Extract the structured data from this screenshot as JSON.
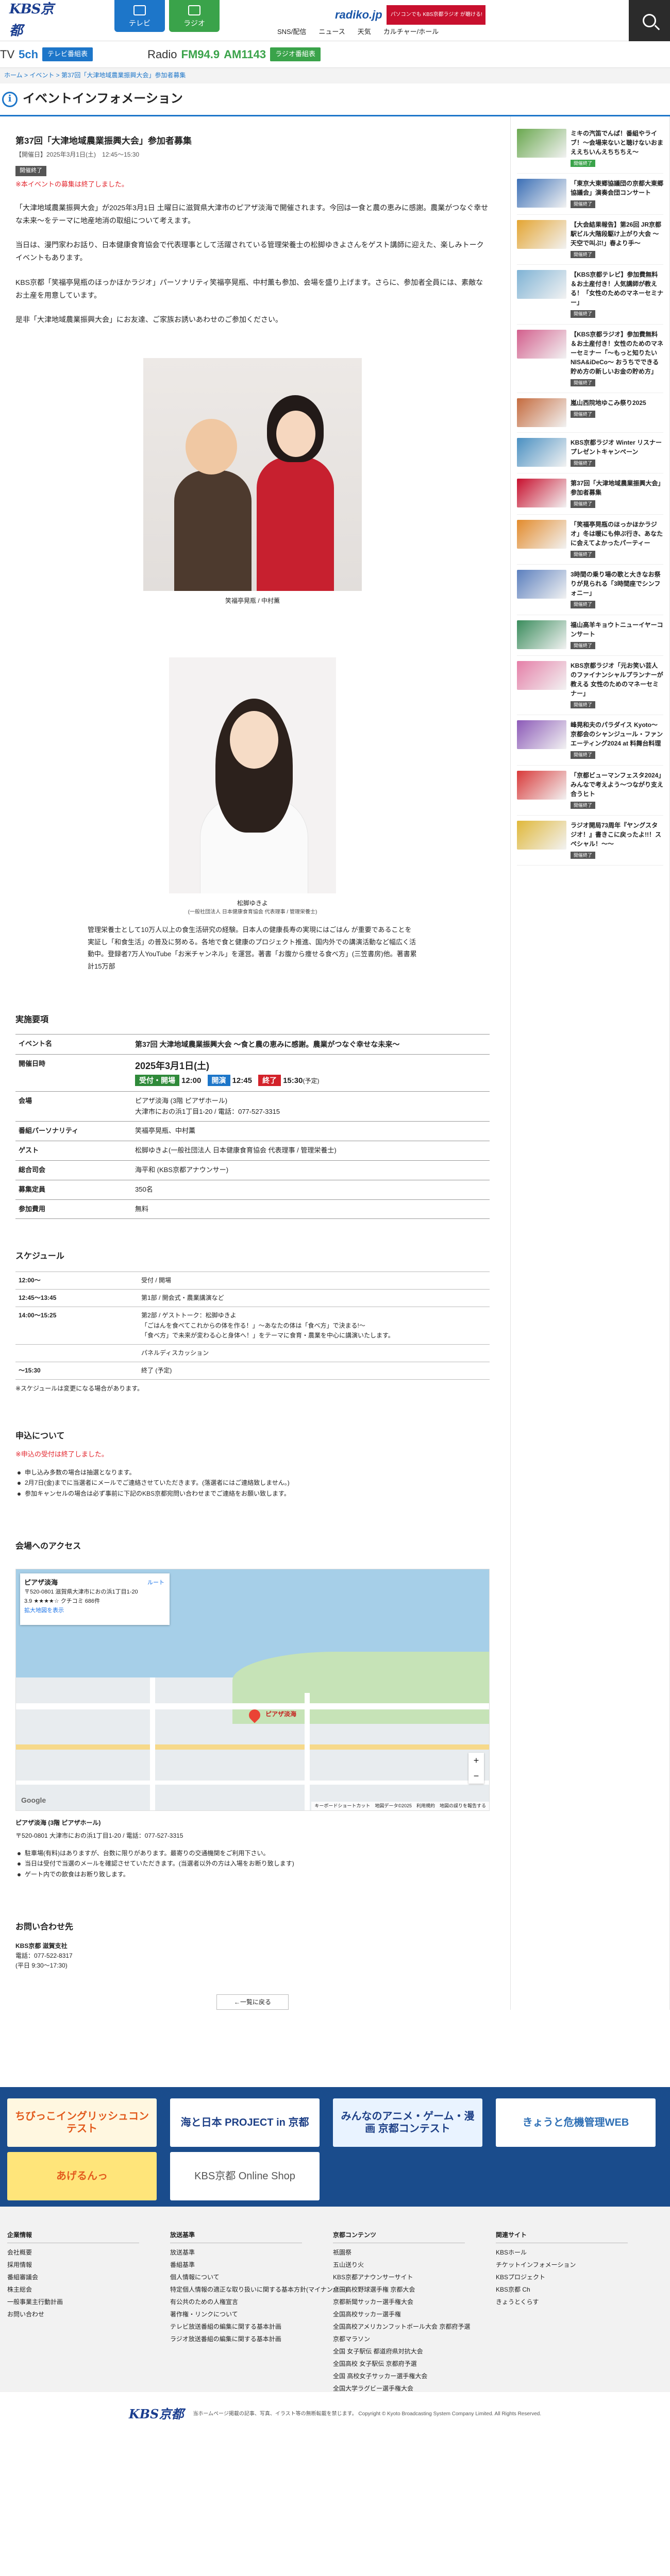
{
  "header": {
    "logo_text": "KBS京都",
    "tabs": [
      {
        "label": "テレビ"
      },
      {
        "label": "ラジオ"
      }
    ],
    "radiko_logo": "radiko.jp",
    "radiko_text": "パソコンでも KBS京都ラジオ が聴ける!",
    "menu": [
      "SNS/配信",
      "ニュース",
      "天気",
      "カルチャー/ホール"
    ]
  },
  "channel_bar": {
    "tv_label": "TV",
    "tv_ch": "5ch",
    "tv_btn": "テレビ番組表",
    "radio_label": "Radio",
    "fm": "FM94.9",
    "am": "AM1143",
    "radio_btn": "ラジオ番組表"
  },
  "breadcrumb": "ホーム > イベント > 第37回「大津地域農業振興大会」参加者募集",
  "page_title": "イベントインフォメーション",
  "article": {
    "title": "第37回「大津地域農業振興大会」参加者募集",
    "meta": "【開催日】2025年3月1日(土)　12:45～15:30",
    "tag": "開催終了",
    "closed_note": "※本イベントの募集は終了しました。",
    "paragraphs": [
      "「大津地域農業振興大会」が2025年3月1日 土曜日に滋賀県大津市のピアザ淡海で開催されます。今回は一食と農の恵みに感謝。農業がつなぐ幸せな未来～をテーマに地産地消の取組について考えます。",
      "当日は、漫門家わお話り、日本健康食育協会で代表理事として活躍されている管理栄養士の松脚ゆきよさんをゲスト講師に迎えた、楽しみトークイベントもあります。",
      "KBS京都「笑福亭晃瓶のほっかほかラジオ」パーソナリティ笑福亭晃瓶、中村薫も参加、会場を盛り上げます。さらに、参加者全員には、素敵なお土産を用意しています。",
      "是非「大津地域農業振興大会」にお友達、ご家族お誘いあわせのご参加ください。"
    ],
    "photo1_caption": "笑福亭晃瓶 / 中村薫",
    "photo2_caption": "松脚ゆきよ",
    "photo2_sub": "(一般社団法人 日本健康食育協会 代表理事 / 管理栄養士)",
    "profile": "管理栄養士として10万人以上の食生活研究の経験。日本人の健康長寿の実現にはごはん が重要であることを実証し「和食生活」の普及に努める。各地で食と健康のプロジェクト推進、国内外での講演活動など幅広く活動中。登録者7万人YouTube「お米チャンネル」を運営。著書「お腹から痩せる食べ方」(三笠書房)他。著書累計15万部"
  },
  "details": {
    "heading": "実施要項",
    "rows": [
      {
        "h": "イベント名",
        "v": "第37回 大津地域農業振興大会 ～食と農の恵みに感謝。農業がつなぐ幸せな未来～"
      },
      {
        "h": "開催日時",
        "date": "2025年3月1日(土)",
        "pill1": "受付・開場",
        "t1": "12:00",
        "pill2": "開演",
        "t2": "12:45",
        "pill3": "終了",
        "t3": "15:30",
        "t3_suffix": "(予定)"
      },
      {
        "h": "会場",
        "v1": "ピアザ淡海 (3階 ピアザホール)",
        "v2": "大津市におの浜1丁目1-20 / 電話：077-527-3315"
      },
      {
        "h": "番組パーソナリティ",
        "v": "笑福亭晃瓶、中村薫"
      },
      {
        "h": "ゲスト",
        "v": "松脚ゆきよ(一般社団法人 日本健康食育協会 代表理事 / 管理栄養士)"
      },
      {
        "h": "総合司会",
        "v": "海平和 (KBS京都アナウンサー)"
      },
      {
        "h": "募集定員",
        "v": "350名"
      },
      {
        "h": "参加費用",
        "v": "無料"
      }
    ]
  },
  "schedule": {
    "heading": "スケジュール",
    "rows": [
      {
        "t": "12:00～",
        "v": "受付 / 開場"
      },
      {
        "t": "12:45～13:45",
        "v": "第1部 / 開会式・農業講演など"
      },
      {
        "t": "14:00～15:25",
        "v": "第2部 / ゲストトーク：松脚ゆきよ\n「ごはんを食べてこれからの体を作る！」～あなたの体は「食べ方」で決まる!～\n「食べ方」で未来が変わる心と身体へ！」をテーマに食育・農業を中心に講演いたします。"
      },
      {
        "t": "",
        "v": "パネルディスカッション"
      },
      {
        "t": "～15:30",
        "v": "終了 (予定)"
      }
    ],
    "note": "※スケジュールは変更になる場合があります。"
  },
  "apply": {
    "heading": "申込について",
    "closed": "※申込の受付は終了しました。",
    "items": [
      "申し込み多数の場合は抽選となります。",
      "2月7日(金)までに当選者にメールでご連絡させていただきます。(落選者にはご連絡致しません。)",
      "参加キャンセルの場合は必ず事前に下記のKBS京都宛問い合わせまでご連絡をお願い致します。"
    ]
  },
  "access": {
    "heading": "会場へのアクセス",
    "map_name": "ピアザ淡海",
    "map_addr": "〒520-0801 滋賀県大津市におの浜1丁目1-20",
    "map_link": "拡大地図を表示",
    "map_route": "ルート",
    "map_rating": "3.9 ★★★★☆ クチコミ 686件",
    "pin_label": "ピアザ淡海",
    "attribution": "キーボードショートカット　地図データ©2025　利用規約　地図の誤りを報告する",
    "google": "Google",
    "venue_name": "ピアザ淡海 (3階 ピアザホール)",
    "venue_addr": "〒520-0801 大津市におの浜1丁目1-20 / 電話：077-527-3315",
    "notes": [
      "駐車場(有料)はありますが、台数に限りがあります。最寄りの交通機関をご利用下さい。",
      "当日は受付で当選のメールを確認させていただきます。(当選者以外の方は入場をお断り致します)",
      "ゲート内での飲食はお断り致します。"
    ]
  },
  "contact": {
    "heading": "お問い合わせ先",
    "name": "KBS京都 滋賀支社",
    "tel": "電話：077-522-8317",
    "hours": "(平日 9:30～17:30)"
  },
  "back_button": "一覧に戻る",
  "sidebar": [
    {
      "title": "ミキの汽笛でんぱ！番組やライブ！～会場来ないと聴けないおまええちいんえちちちえ～",
      "badge": "開催終了",
      "color": "#6aa84f"
    },
    {
      "title": "「東京大東郷協議団の京都大東郷協議会」演奏会団コンサート",
      "badge": "開催終了",
      "color": "#3b6fb6"
    },
    {
      "title": "【大会結果報告】第26回 JR京都駅ビル大階段駆け上がり大会 ～天空で叫ぶ!」春より手～",
      "badge": "開催終了",
      "color": "#e4a532"
    },
    {
      "title": "【KBS京都テレビ】参加費無料＆お土産付き！人気講師が教える！「女性のためのマネーセミナー」",
      "badge": "開催終了",
      "color": "#7fb3d5"
    },
    {
      "title": "【KBS京都ラジオ】参加費無料＆お土産付き！女性のためのマネーセミナー「～もっと知りたいNISA&iDeCo～ おうちでできる貯め方の新しいお金の貯め方」",
      "badge": "開催終了",
      "color": "#d35f8d"
    },
    {
      "title": "嵐山西院地ゆこみ祭り2025",
      "badge": "開催終了",
      "color": "#c56b3e"
    },
    {
      "title": "KBS京都ラジオ Winter リスナープレゼントキャンペーン",
      "badge": "開催終了",
      "color": "#4a90c2"
    },
    {
      "title": "第37回「大津地域農業振興大会」参加者募集",
      "badge": "開催終了",
      "color": "#c8102e"
    },
    {
      "title": "「笑福亭晃瓶のほっかほかラジオ」冬は暖にも伸ぶ行き、あなたに会えてよかったパーティー",
      "badge": "開催終了",
      "color": "#e38b2c"
    },
    {
      "title": "3時間の乗り場の歌と大きなお祭りが見られる「3時間座でシンフォニー」",
      "badge": "開催終了",
      "color": "#5b7fbe"
    },
    {
      "title": "福山高羊キョウトニューイヤーコンサート",
      "badge": "開催終了",
      "color": "#3a8c5c"
    },
    {
      "title": "KBS京都ラジオ「元お笑い芸人のファイナンシャルプランナーが教える 女性のためのマネーセミナー」",
      "badge": "開催終了",
      "color": "#e57fa8"
    },
    {
      "title": "峰晃和夫のパラダイス Kyoto～京都会のシャンジュール・ファンエーティング2024 at 料舞台料理",
      "badge": "開催終了",
      "color": "#8c5ab8"
    },
    {
      "title": "「京都ビューマンフェスタ2024」みんなで考えよう～つながり支え合うヒト",
      "badge": "開催終了",
      "color": "#d93a3a"
    },
    {
      "title": "ラジオ開局73周年『ヤングスタジオ！』書きこに戻ったよ!!！スペシャル！～～",
      "badge": "開催終了",
      "color": "#e0b83a"
    }
  ],
  "banners": [
    "ちびっこイングリッシュコンテスト",
    "海と日本 PROJECT in 京都",
    "みんなのアニメ・ゲーム・漫画 京都コンテスト",
    "きょうと危機管理WEB",
    "あげるんっ",
    "KBS京都 Online Shop"
  ],
  "footer": {
    "cols": [
      {
        "title": "企業情報",
        "items": [
          "会社概要",
          "採用情報",
          "番組審議会",
          "株主総会",
          "一般事業主行動計画",
          "お問い合わせ"
        ]
      },
      {
        "title": "放送基準",
        "items": [
          "放送基準",
          "番組基準",
          "個人情報について",
          "特定個人情報の適正な取り扱いに関する基本方針(マイナンバー)",
          "有公共のための人権宣言",
          "著作権・リンクについて",
          "テレビ放送番組の編集に関する基本計画",
          "ラジオ放送番組の編集に関する基本計画"
        ]
      },
      {
        "title": "京都コンテンツ",
        "items": [
          "祇園祭",
          "五山送り火",
          "KBS京都アナウンサーサイト",
          "全国高校野球選手権 京都大会",
          "京都新聞サッカー選手権大会",
          "全国高校サッカー選手権",
          "全国高校アメリカンフットボール大会 京都府予選",
          "京都マラソン",
          "全国 女子駅伝 都道府県対抗大会",
          "全国高校 女子駅伝 京都府予選",
          "全国 高校女子サッカー選手権大会",
          "全国大学ラグビー選手権大会"
        ]
      },
      {
        "title": "関連サイト",
        "items": [
          "KBSホール",
          "チケットインフォメーション",
          "KBSプロジェクト",
          "KBS京都 Ch",
          "きょうとくらす"
        ]
      }
    ],
    "copy_logo": "KBS京都",
    "copyright": "当ホームページ掲載の記事、写真、イラスト等の無断転載を禁じます。 Copyright © Kyoto Broadcasting System Company Limited. All Rights Reserved."
  }
}
